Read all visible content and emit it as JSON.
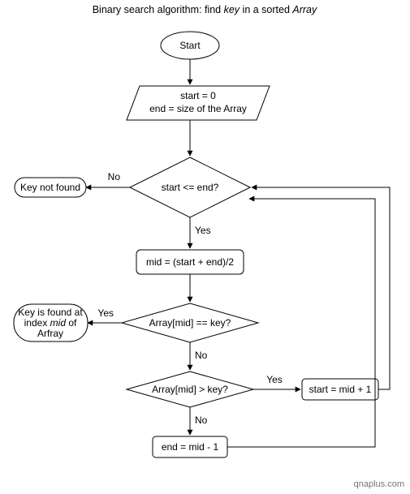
{
  "diagram": {
    "title_1": "Binary search algorithm: find ",
    "title_key": "key",
    "title_2": " in a sorted ",
    "title_array": "Array",
    "start": "Start",
    "init_line1": "start = 0",
    "init_line2": "end = size of the Array",
    "decision_loop": "start <= end?",
    "process_mid": "mid = (start + end)/2",
    "decision_eq": "Array[mid] == key?",
    "decision_gt": "Array[mid] > key?",
    "process_start_up": "start = mid + 1",
    "process_end_down": "end = mid - 1",
    "term_notfound": "Key not found",
    "term_found_l1": "Key is found at",
    "term_found_l2a": "index ",
    "term_found_mid": "mid",
    "term_found_l2b": " of",
    "term_found_l3": "Arfray",
    "edge_yes": "Yes",
    "edge_no": "No",
    "watermark": "qnaplus.com"
  }
}
